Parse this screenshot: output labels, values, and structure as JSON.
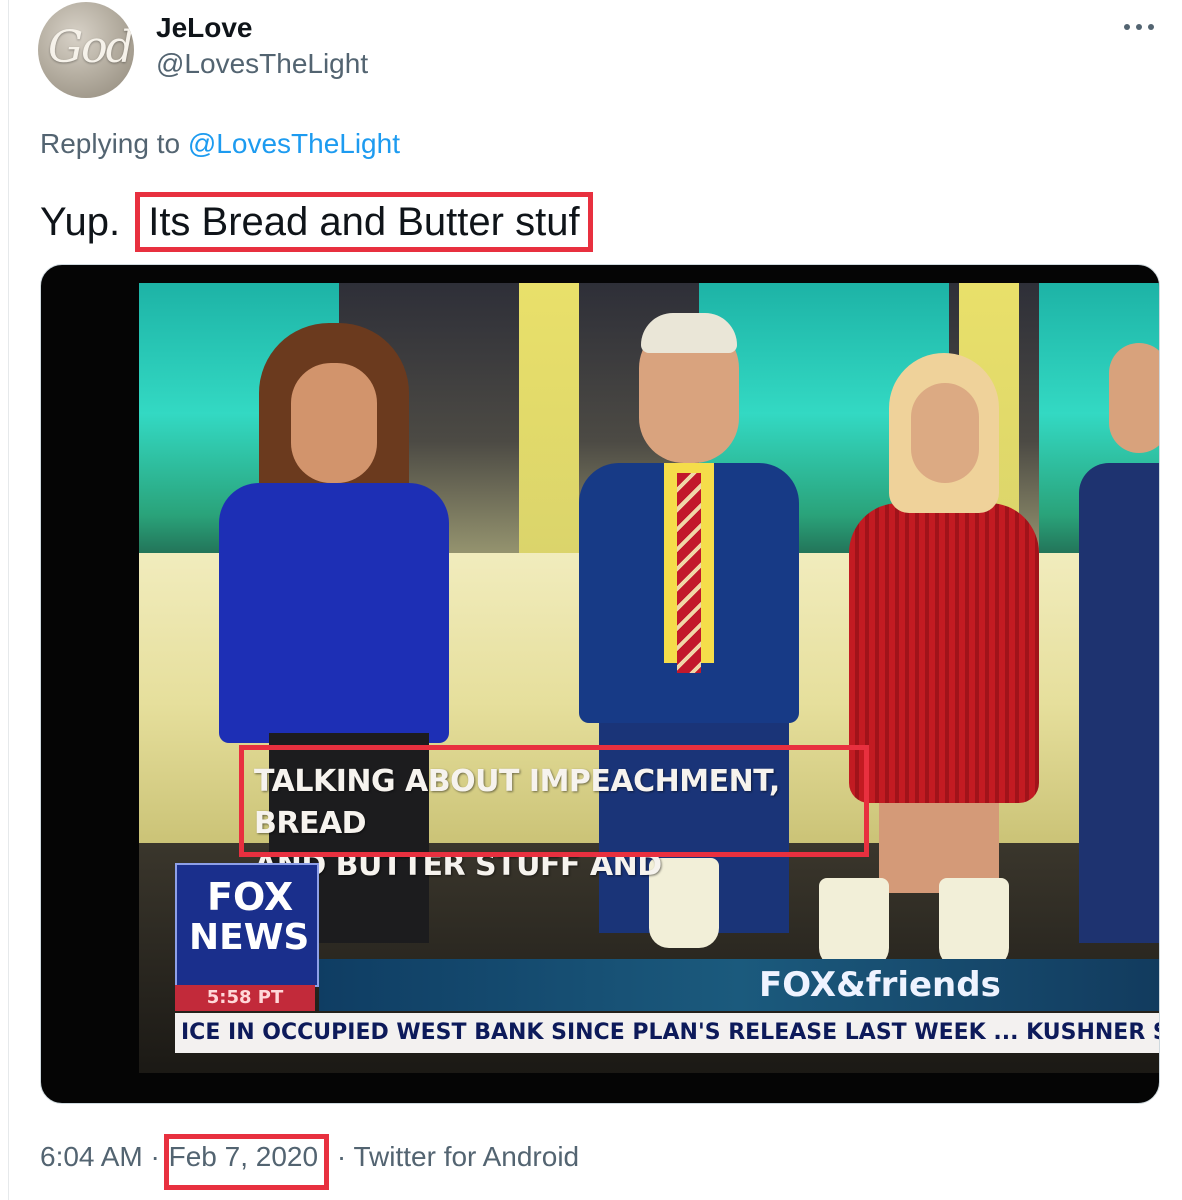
{
  "user": {
    "avatar_text": "God",
    "display_name": "JeLove",
    "handle": "@LovesTheLight"
  },
  "reply": {
    "prefix": "Replying to",
    "mention": "@LovesTheLight"
  },
  "tweet": {
    "text_start": "Yup.",
    "text_highlight": "Its Bread and Butter stuf"
  },
  "media": {
    "caption_line1": "TALKING ABOUT IMPEACHMENT, BREAD",
    "caption_line2": "AND BUTTER STUFF AND",
    "logo_line1": "FOX",
    "logo_line2": "NEWS",
    "time_badge": "5:58 PT",
    "show_name": "FOX&friends",
    "ticker": "ICE IN OCCUPIED WEST BANK SINCE PLAN'S RELEASE LAST WEEK ... KUSHNER SAID TH"
  },
  "meta": {
    "time": "6:04 AM",
    "separator": "·",
    "date": "Feb 7, 2020",
    "client": "Twitter for Android"
  },
  "colors": {
    "highlight_box": "#e8303f",
    "link": "#1d9bf0",
    "muted_text": "#536471"
  },
  "icons": [
    "more-horizontal-icon"
  ]
}
